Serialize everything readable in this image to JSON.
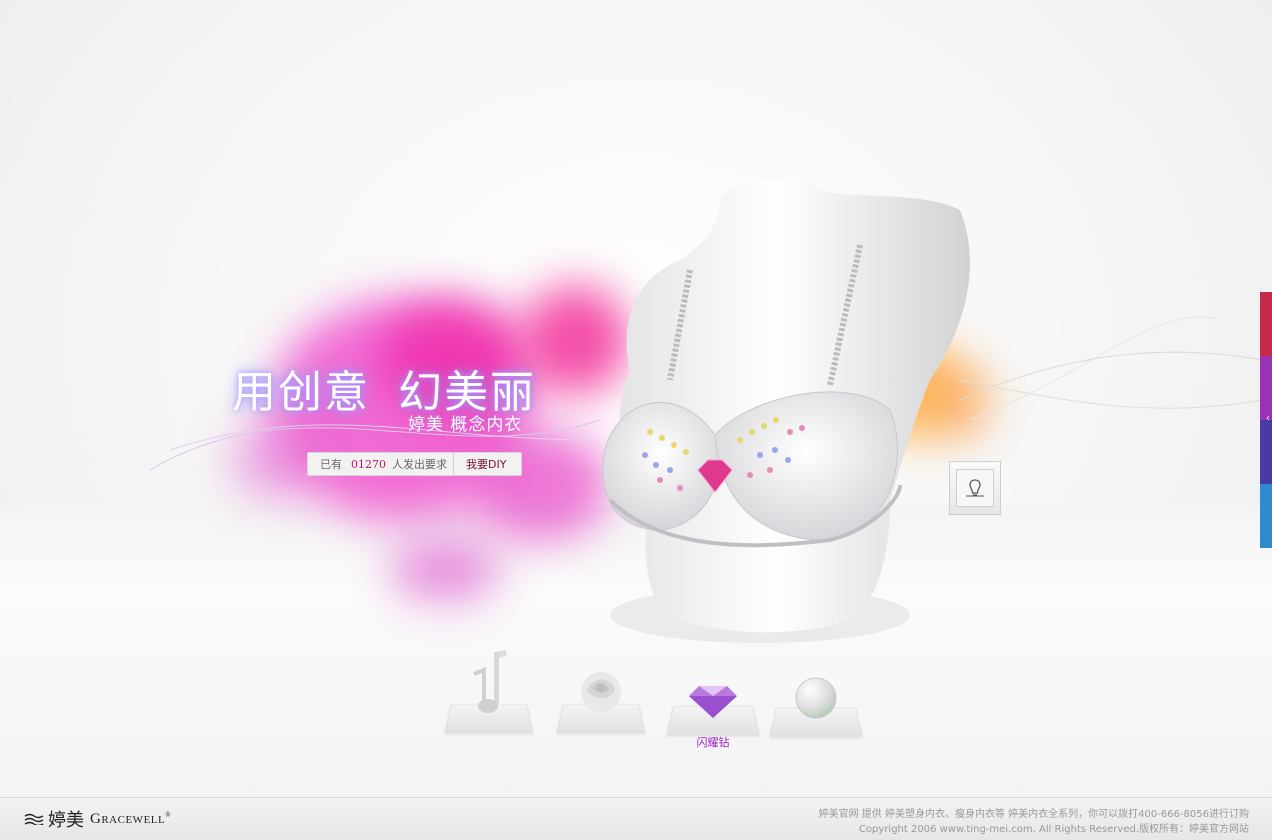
{
  "hero": {
    "title_part1": "用创意",
    "title_part2": "幻美丽",
    "subtitle": "婷美 概念内衣"
  },
  "counter": {
    "prefix": "已有",
    "count": "01270",
    "suffix": "人发出要求",
    "cta_label": "我要DIY"
  },
  "options": [
    {
      "icon": "music-note-icon",
      "label": ""
    },
    {
      "icon": "rose-icon",
      "label": ""
    },
    {
      "icon": "diamond-icon",
      "label": "闪耀钻"
    },
    {
      "icon": "pearl-icon",
      "label": ""
    }
  ],
  "light_button": {
    "icon": "light-bulb-icon"
  },
  "side_tabs": {
    "colors": [
      "#c8284a",
      "#9a32b8",
      "#4a3aa8",
      "#2f8ad0"
    ]
  },
  "footer": {
    "logo_cn": "婷美",
    "logo_en_big": "G",
    "logo_en_rest": "RACEWELL",
    "logo_mark": "®",
    "line1": "婷美官网 提供 婷美塑身内衣、瘦身内衣等 婷美内衣全系列，你可以拨打400-666-8056进行订购",
    "line2": "Copyright 2006 www.ting-mei.com. All Rights Reserved.版权所有：婷美官方网站"
  },
  "colors": {
    "accent_pink": "#c0125a",
    "diamond_label": "#a020c8"
  }
}
